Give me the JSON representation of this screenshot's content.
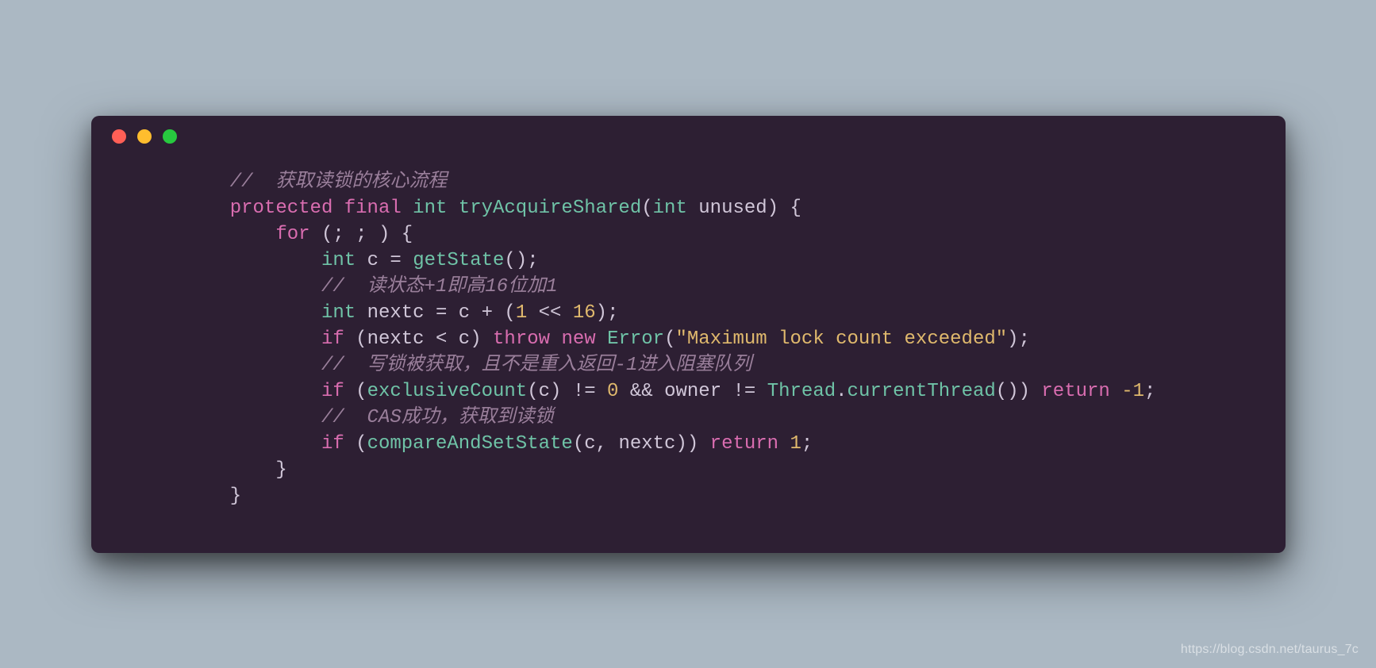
{
  "watermark": "https://blog.csdn.net/taurus_7c",
  "code": {
    "indent1": "        ",
    "indent2": "            ",
    "indent3": "                ",
    "comment1": "//  获取读锁的核心流程",
    "kw_protected": "protected",
    "kw_final": "final",
    "kw_int": "int",
    "fn_tryAcquireShared": "tryAcquireShared",
    "param_unused": "unused",
    "kw_for": "for",
    "var_c": "c",
    "fn_getState": "getState",
    "comment2": "//  读状态+1即高16位加1",
    "var_nextc": "nextc",
    "num_1": "1",
    "op_shift": "<<",
    "num_16": "16",
    "kw_if": "if",
    "kw_throw": "throw",
    "kw_new": "new",
    "cls_Error": "Error",
    "str_max": "\"Maximum lock count exceeded\"",
    "comment3": "//  写锁被获取，且不是重入返回-1进入阻塞队列",
    "fn_exclusiveCount": "exclusiveCount",
    "num_0": "0",
    "op_and": "&&",
    "var_owner": "owner",
    "cls_Thread": "Thread",
    "fn_currentThread": "currentThread",
    "kw_return": "return",
    "num_neg1": "-1",
    "comment4": "//  CAS成功，获取到读锁",
    "fn_compareAndSetState": "compareAndSetState",
    "num_1b": "1",
    "op_eq": "=",
    "op_plus": "+",
    "op_lt": "<",
    "op_neq": "!=",
    "brace_o": "{",
    "brace_c": "}",
    "paren_o": "(",
    "paren_c": ")",
    "semi": ";",
    "comma": ",",
    "dot": ".",
    "sp": " "
  }
}
